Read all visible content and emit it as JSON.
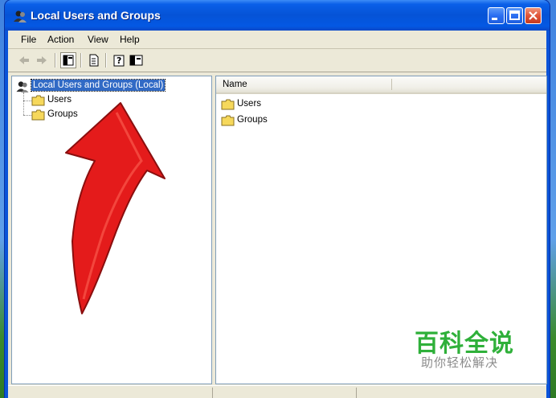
{
  "window": {
    "title": "Local Users and Groups"
  },
  "menu": {
    "items": [
      "File",
      "Action",
      "View",
      "Help"
    ]
  },
  "tree": {
    "root": "Local Users and Groups (Local)",
    "children": [
      "Users",
      "Groups"
    ]
  },
  "list": {
    "column_header": "Name",
    "items": [
      "Users",
      "Groups"
    ]
  },
  "watermark": {
    "title": "百科全说",
    "subtitle": "助你轻松解决"
  },
  "colors": {
    "selection": "#316ac5",
    "annotation_arrow": "#e41b1b",
    "watermark_green": "#2fb03a"
  },
  "icons": [
    "back-icon",
    "forward-icon",
    "show-hide-tree-icon",
    "export-list-icon",
    "help-icon",
    "console-icon",
    "folder-icon"
  ]
}
